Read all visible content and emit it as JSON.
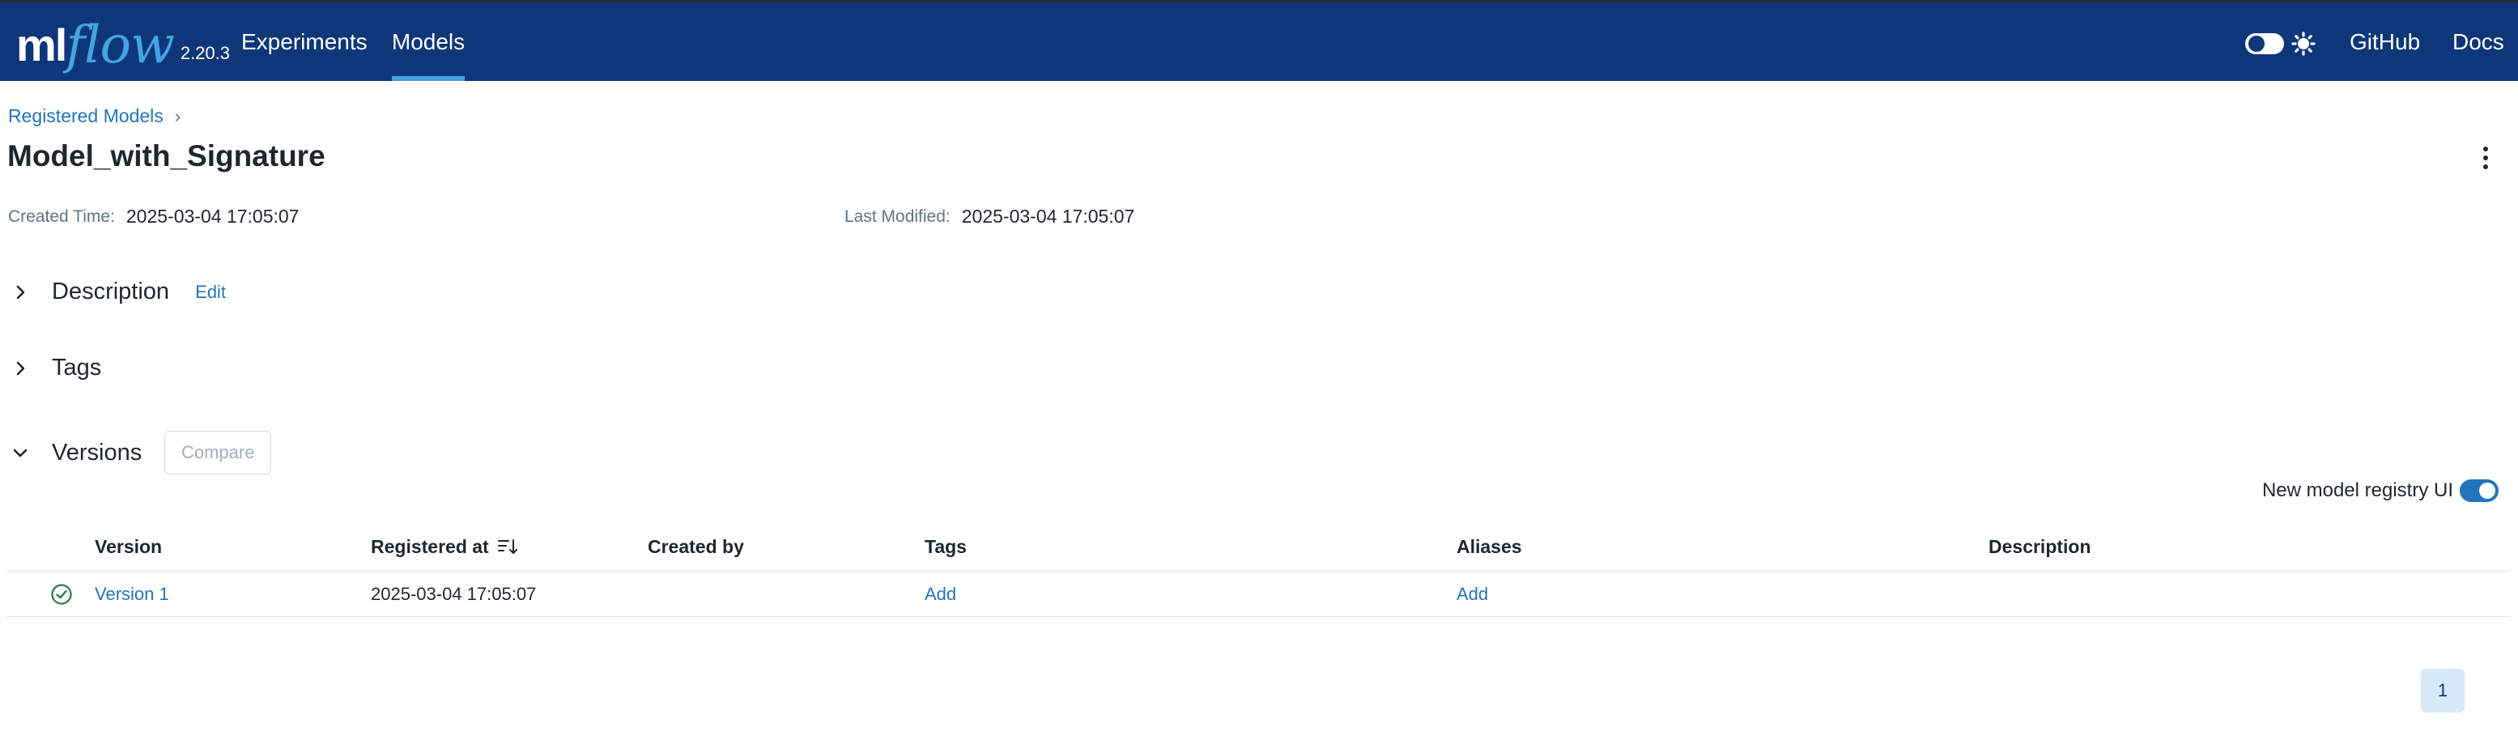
{
  "app": {
    "logo_ml": "ml",
    "logo_flow": "flow",
    "version": "2.20.3"
  },
  "nav": {
    "experiments": "Experiments",
    "models": "Models",
    "github": "GitHub",
    "docs": "Docs",
    "active": "Models"
  },
  "breadcrumb": {
    "parent": "Registered Models",
    "separator": "›"
  },
  "model": {
    "name": "Model_with_Signature",
    "created_label": "Created Time:",
    "created_value": "2025-03-04 17:05:07",
    "modified_label": "Last Modified:",
    "modified_value": "2025-03-04 17:05:07"
  },
  "sections": {
    "description": "Description",
    "edit": "Edit",
    "tags": "Tags",
    "versions": "Versions",
    "compare": "Compare"
  },
  "registry_toggle": {
    "label": "New model registry UI",
    "enabled": true
  },
  "table": {
    "headers": {
      "version": "Version",
      "registered_at": "Registered at",
      "created_by": "Created by",
      "tags": "Tags",
      "aliases": "Aliases",
      "description": "Description"
    },
    "rows": [
      {
        "status_icon": "check-circle-icon",
        "version": "Version 1",
        "registered_at": "2025-03-04 17:05:07",
        "created_by": "",
        "tags": "Add",
        "aliases": "Add",
        "description": ""
      }
    ]
  },
  "pagination": {
    "current": "1"
  },
  "colors": {
    "header_bg": "#0e3779",
    "accent": "#43a4e0",
    "link": "#2374bb",
    "success": "#277c43"
  }
}
